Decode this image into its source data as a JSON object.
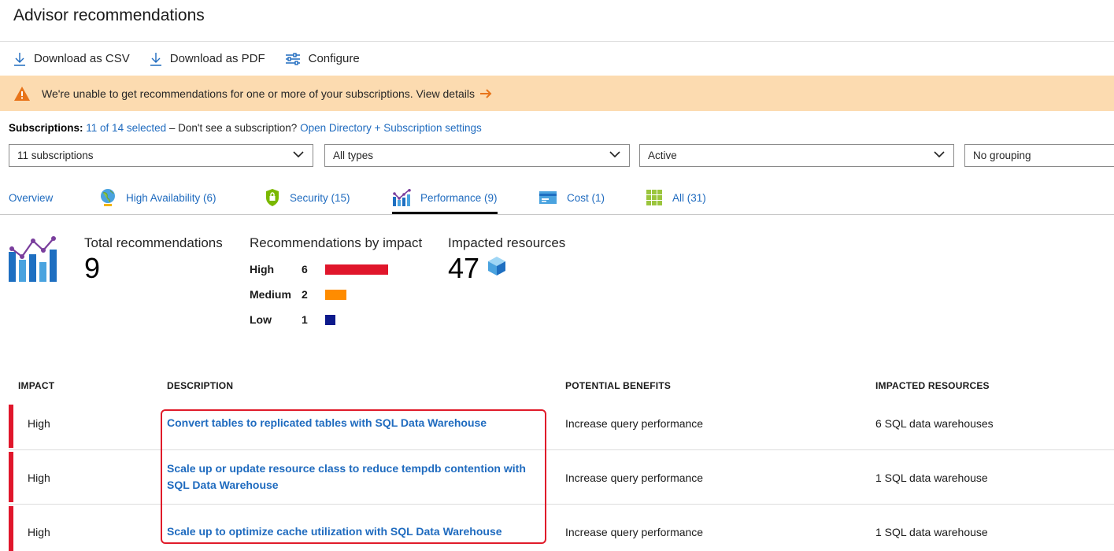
{
  "header": {
    "title": "Advisor recommendations"
  },
  "toolbar": {
    "download_csv": "Download as CSV",
    "download_pdf": "Download as PDF",
    "configure": "Configure"
  },
  "warning": {
    "text": "We're unable to get recommendations for one or more of your subscriptions. View details"
  },
  "subscriptions": {
    "label": "Subscriptions:",
    "selected": "11 of 14 selected",
    "hint": "– Don't see a subscription?",
    "settings_link": "Open Directory + Subscription settings"
  },
  "filters": {
    "subscriptions": "11 subscriptions",
    "types": "All types",
    "status": "Active",
    "grouping": "No grouping"
  },
  "tabs": [
    {
      "label": "Overview"
    },
    {
      "label": "High Availability (6)"
    },
    {
      "label": "Security (15)"
    },
    {
      "label": "Performance (9)"
    },
    {
      "label": "Cost (1)"
    },
    {
      "label": "All (31)"
    }
  ],
  "summary": {
    "total_label": "Total recommendations",
    "total_value": "9",
    "by_impact_label": "Recommendations by impact",
    "impacts": [
      {
        "name": "High",
        "count": "6",
        "color": "#e0162b",
        "fraction": 1.0
      },
      {
        "name": "Medium",
        "count": "2",
        "color": "#ff8c00",
        "fraction": 0.333
      },
      {
        "name": "Low",
        "count": "1",
        "color": "#0d1a8c",
        "fraction": 0.167
      }
    ],
    "resources_label": "Impacted resources",
    "resources_value": "47"
  },
  "table": {
    "headers": [
      "IMPACT",
      "DESCRIPTION",
      "POTENTIAL BENEFITS",
      "IMPACTED RESOURCES"
    ],
    "rows": [
      {
        "impact": "High",
        "description": "Convert tables to replicated tables with SQL Data Warehouse",
        "benefit": "Increase query performance",
        "resources": "6 SQL data warehouses"
      },
      {
        "impact": "High",
        "description": "Scale up or update resource class to reduce tempdb contention with SQL Data Warehouse",
        "benefit": "Increase query performance",
        "resources": "1 SQL data warehouse"
      },
      {
        "impact": "High",
        "description": "Scale up to optimize cache utilization with SQL Data Warehouse",
        "benefit": "Increase query performance",
        "resources": "1 SQL data warehouse"
      }
    ]
  },
  "colors": {
    "link": "#1f6bbf",
    "high": "#e0162b",
    "medium": "#ff8c00",
    "low": "#0d1a8c",
    "warning_bg": "#fcdbb0"
  }
}
